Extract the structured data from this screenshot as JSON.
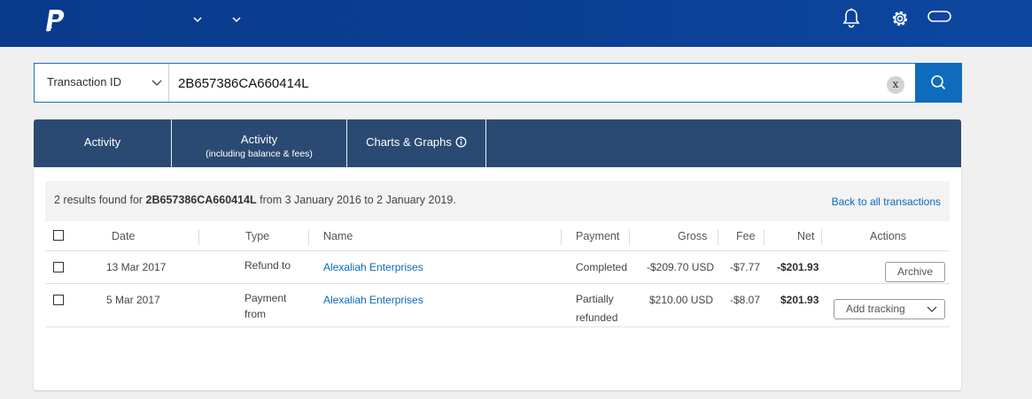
{
  "header": {
    "icons": [
      "paypal-logo",
      "chevron-down-icon",
      "chevron-down-icon",
      "bell-icon",
      "gear-icon",
      "account-pill-icon"
    ]
  },
  "search": {
    "filter_label": "Transaction ID",
    "query": "2B657386CA660414L",
    "clear_label": "x",
    "icons": [
      "chevron-down-icon",
      "clear-icon",
      "search-icon"
    ]
  },
  "tabs": [
    {
      "label": "Activity",
      "sub": ""
    },
    {
      "label": "Activity",
      "sub": "(including balance & fees)"
    },
    {
      "label": "Charts & Graphs",
      "sub": "",
      "icon": "info-icon"
    }
  ],
  "results": {
    "prefix": "2 results found for",
    "query": "2B657386CA660414L",
    "suffix": "from 3 January 2016 to 2 January 2019.",
    "back_link": "Back to all transactions"
  },
  "table": {
    "columns": [
      "Date",
      "Type",
      "Name",
      "Payment",
      "Gross",
      "Fee",
      "Net",
      "Actions"
    ],
    "rows": [
      {
        "date": "13 Mar 2017",
        "type_1": "Refund to",
        "type_2": "",
        "name": "Alexaliah Enterprises",
        "payment_1": "Completed",
        "payment_2": "",
        "gross": "-$209.70 USD",
        "fee": "-$7.77",
        "net": "-$201.93",
        "action": "Archive"
      },
      {
        "date": "5 Mar 2017",
        "type_1": "Payment",
        "type_2": "from",
        "name": "Alexaliah Enterprises",
        "payment_1": "Partially",
        "payment_2": "refunded",
        "gross": "$210.00 USD",
        "fee": "-$8.07",
        "net": "$201.93",
        "action": "Add tracking"
      }
    ]
  },
  "colors": {
    "header_bg": "#0b3f94",
    "tab_bg": "#2b4a73",
    "search_button": "#0f6cbd",
    "link": "#0a6ab8"
  }
}
